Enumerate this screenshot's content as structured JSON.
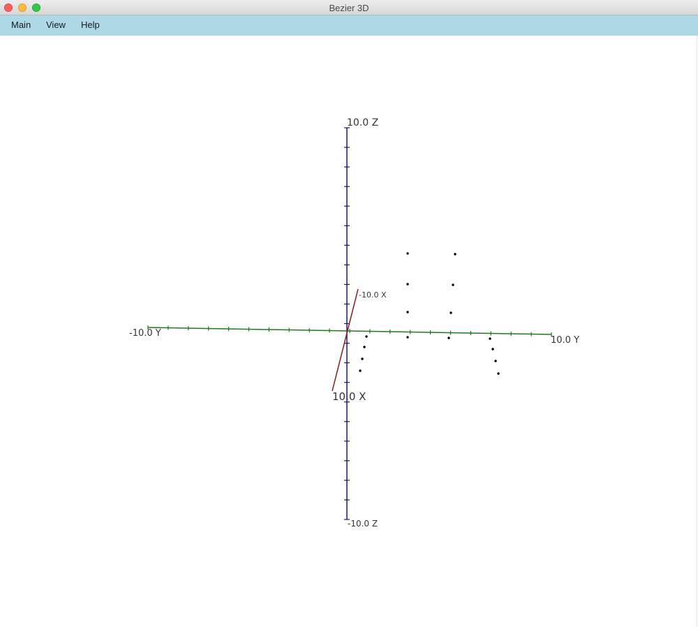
{
  "window": {
    "title": "Bezier 3D"
  },
  "menu": {
    "items": [
      "Main",
      "View",
      "Help"
    ]
  },
  "axes": {
    "z_pos_label": "10.0 Z",
    "z_neg_label": "-10.0 Z",
    "y_neg_label": "-10.0 Y",
    "y_pos_label": "10.0 Y",
    "x_neg_label": "-10.0 X",
    "x_pos_label": "10.0 X",
    "colors": {
      "x": "#8b1a1a",
      "y": "#1e7a1e",
      "z": "#1a1a6e"
    }
  },
  "control_points": {
    "color": "#000000",
    "grid_size": "4x4",
    "count": 16
  }
}
